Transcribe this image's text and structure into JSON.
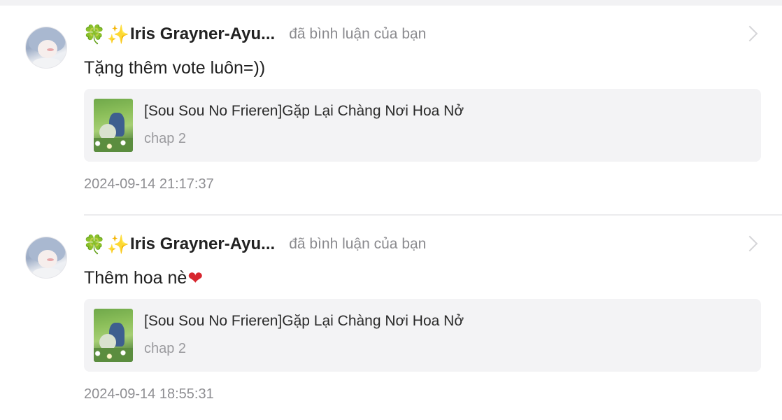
{
  "notifications": [
    {
      "user": {
        "emoji_prefix": [
          "🍀",
          "✨"
        ],
        "name": "Iris Grayner-Ayu..."
      },
      "action": "đã bình luận của bạn",
      "comment": "Tặng thêm vote luôn=))",
      "comment_emoji": "",
      "card": {
        "title": "[Sou Sou No Frieren]Gặp Lại Chàng Nơi Hoa Nở",
        "subtitle": "chap 2"
      },
      "timestamp": "2024-09-14 21:17:37"
    },
    {
      "user": {
        "emoji_prefix": [
          "🍀",
          "✨"
        ],
        "name": "Iris Grayner-Ayu..."
      },
      "action": "đã bình luận của bạn",
      "comment": "Thêm hoa nè",
      "comment_emoji": "❤",
      "card": {
        "title": "[Sou Sou No Frieren]Gặp Lại Chàng Nơi Hoa Nở",
        "subtitle": "chap 2"
      },
      "timestamp": "2024-09-14 18:55:31"
    }
  ],
  "icons": {
    "chevron": "chevron-right-icon",
    "heart_color": "#d7262e",
    "clover_color": "#3fa34d",
    "sparkle_color": "#f5b82e"
  }
}
